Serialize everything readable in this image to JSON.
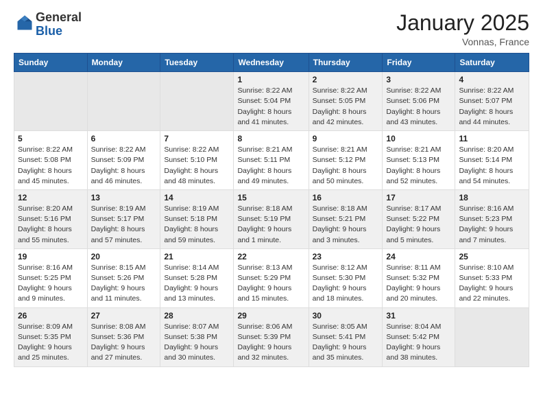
{
  "header": {
    "logo_general": "General",
    "logo_blue": "Blue",
    "month_title": "January 2025",
    "location": "Vonnas, France"
  },
  "weekdays": [
    "Sunday",
    "Monday",
    "Tuesday",
    "Wednesday",
    "Thursday",
    "Friday",
    "Saturday"
  ],
  "weeks": [
    [
      {
        "num": "",
        "info": "",
        "empty": true
      },
      {
        "num": "",
        "info": "",
        "empty": true
      },
      {
        "num": "",
        "info": "",
        "empty": true
      },
      {
        "num": "1",
        "info": "Sunrise: 8:22 AM\nSunset: 5:04 PM\nDaylight: 8 hours\nand 41 minutes."
      },
      {
        "num": "2",
        "info": "Sunrise: 8:22 AM\nSunset: 5:05 PM\nDaylight: 8 hours\nand 42 minutes."
      },
      {
        "num": "3",
        "info": "Sunrise: 8:22 AM\nSunset: 5:06 PM\nDaylight: 8 hours\nand 43 minutes."
      },
      {
        "num": "4",
        "info": "Sunrise: 8:22 AM\nSunset: 5:07 PM\nDaylight: 8 hours\nand 44 minutes."
      }
    ],
    [
      {
        "num": "5",
        "info": "Sunrise: 8:22 AM\nSunset: 5:08 PM\nDaylight: 8 hours\nand 45 minutes."
      },
      {
        "num": "6",
        "info": "Sunrise: 8:22 AM\nSunset: 5:09 PM\nDaylight: 8 hours\nand 46 minutes."
      },
      {
        "num": "7",
        "info": "Sunrise: 8:22 AM\nSunset: 5:10 PM\nDaylight: 8 hours\nand 48 minutes."
      },
      {
        "num": "8",
        "info": "Sunrise: 8:21 AM\nSunset: 5:11 PM\nDaylight: 8 hours\nand 49 minutes."
      },
      {
        "num": "9",
        "info": "Sunrise: 8:21 AM\nSunset: 5:12 PM\nDaylight: 8 hours\nand 50 minutes."
      },
      {
        "num": "10",
        "info": "Sunrise: 8:21 AM\nSunset: 5:13 PM\nDaylight: 8 hours\nand 52 minutes."
      },
      {
        "num": "11",
        "info": "Sunrise: 8:20 AM\nSunset: 5:14 PM\nDaylight: 8 hours\nand 54 minutes."
      }
    ],
    [
      {
        "num": "12",
        "info": "Sunrise: 8:20 AM\nSunset: 5:16 PM\nDaylight: 8 hours\nand 55 minutes."
      },
      {
        "num": "13",
        "info": "Sunrise: 8:19 AM\nSunset: 5:17 PM\nDaylight: 8 hours\nand 57 minutes."
      },
      {
        "num": "14",
        "info": "Sunrise: 8:19 AM\nSunset: 5:18 PM\nDaylight: 8 hours\nand 59 minutes."
      },
      {
        "num": "15",
        "info": "Sunrise: 8:18 AM\nSunset: 5:19 PM\nDaylight: 9 hours\nand 1 minute."
      },
      {
        "num": "16",
        "info": "Sunrise: 8:18 AM\nSunset: 5:21 PM\nDaylight: 9 hours\nand 3 minutes."
      },
      {
        "num": "17",
        "info": "Sunrise: 8:17 AM\nSunset: 5:22 PM\nDaylight: 9 hours\nand 5 minutes."
      },
      {
        "num": "18",
        "info": "Sunrise: 8:16 AM\nSunset: 5:23 PM\nDaylight: 9 hours\nand 7 minutes."
      }
    ],
    [
      {
        "num": "19",
        "info": "Sunrise: 8:16 AM\nSunset: 5:25 PM\nDaylight: 9 hours\nand 9 minutes."
      },
      {
        "num": "20",
        "info": "Sunrise: 8:15 AM\nSunset: 5:26 PM\nDaylight: 9 hours\nand 11 minutes."
      },
      {
        "num": "21",
        "info": "Sunrise: 8:14 AM\nSunset: 5:28 PM\nDaylight: 9 hours\nand 13 minutes."
      },
      {
        "num": "22",
        "info": "Sunrise: 8:13 AM\nSunset: 5:29 PM\nDaylight: 9 hours\nand 15 minutes."
      },
      {
        "num": "23",
        "info": "Sunrise: 8:12 AM\nSunset: 5:30 PM\nDaylight: 9 hours\nand 18 minutes."
      },
      {
        "num": "24",
        "info": "Sunrise: 8:11 AM\nSunset: 5:32 PM\nDaylight: 9 hours\nand 20 minutes."
      },
      {
        "num": "25",
        "info": "Sunrise: 8:10 AM\nSunset: 5:33 PM\nDaylight: 9 hours\nand 22 minutes."
      }
    ],
    [
      {
        "num": "26",
        "info": "Sunrise: 8:09 AM\nSunset: 5:35 PM\nDaylight: 9 hours\nand 25 minutes."
      },
      {
        "num": "27",
        "info": "Sunrise: 8:08 AM\nSunset: 5:36 PM\nDaylight: 9 hours\nand 27 minutes."
      },
      {
        "num": "28",
        "info": "Sunrise: 8:07 AM\nSunset: 5:38 PM\nDaylight: 9 hours\nand 30 minutes."
      },
      {
        "num": "29",
        "info": "Sunrise: 8:06 AM\nSunset: 5:39 PM\nDaylight: 9 hours\nand 32 minutes."
      },
      {
        "num": "30",
        "info": "Sunrise: 8:05 AM\nSunset: 5:41 PM\nDaylight: 9 hours\nand 35 minutes."
      },
      {
        "num": "31",
        "info": "Sunrise: 8:04 AM\nSunset: 5:42 PM\nDaylight: 9 hours\nand 38 minutes."
      },
      {
        "num": "",
        "info": "",
        "empty": true
      }
    ]
  ]
}
